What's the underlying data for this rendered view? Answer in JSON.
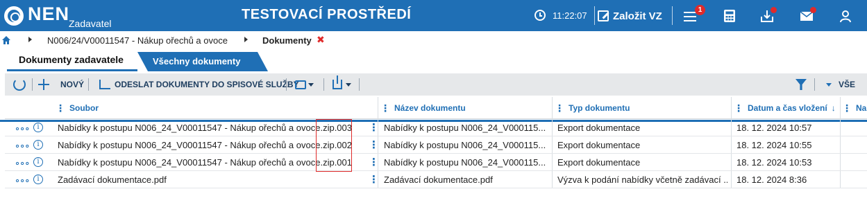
{
  "header": {
    "logo_text": "NEN",
    "logo_sub": "Zadavatel",
    "env_title": "TESTOVACÍ PROSTŘEDÍ",
    "clock": "11:22:07",
    "create_label": "Založit VZ",
    "notifications_badge": "1",
    "accent_color": "#1f6fb5",
    "alert_color": "#e02a2a"
  },
  "breadcrumb": {
    "items": [
      "N006/24/V00011547 - Nákup ořechů a ovoce",
      "Dokumenty"
    ]
  },
  "tabs": [
    {
      "label": "Dokumenty zadavatele",
      "active": true
    },
    {
      "label": "Všechny dokumenty",
      "active": false
    }
  ],
  "toolbar": {
    "new_label": "NOVÝ",
    "send_label": "ODESLAT DOKUMENTY DO SPISOVÉ SLUŽBY",
    "all_label": "VŠE"
  },
  "grid": {
    "columns": [
      "Soubor",
      "Název dokumentu",
      "Typ dokumentu",
      "Datum a čas vložení",
      "Na"
    ],
    "rows": [
      {
        "file": "Nabídky k postupu N006_24_V00011547 - Nákup ořechů a ovoce.zip.003",
        "name": "Nabídky k postupu N006_24_V000115...",
        "type": "Export dokumentace",
        "date": "18. 12. 2024 10:57"
      },
      {
        "file": "Nabídky k postupu N006_24_V00011547 - Nákup ořechů a ovoce.zip.002",
        "name": "Nabídky k postupu N006_24_V000115...",
        "type": "Export dokumentace",
        "date": "18. 12. 2024 10:55"
      },
      {
        "file": "Nabídky k postupu N006_24_V00011547 - Nákup ořechů a ovoce.zip.001",
        "name": "Nabídky k postupu N006_24_V000115...",
        "type": "Export dokumentace",
        "date": "18. 12. 2024 10:53"
      },
      {
        "file": "Zadávací dokumentace.pdf",
        "name": "Zadávací dokumentace.pdf",
        "type": "Výzva k podání nabídky včetně zadávací ...",
        "date": "18. 12. 2024 8:36"
      }
    ]
  }
}
